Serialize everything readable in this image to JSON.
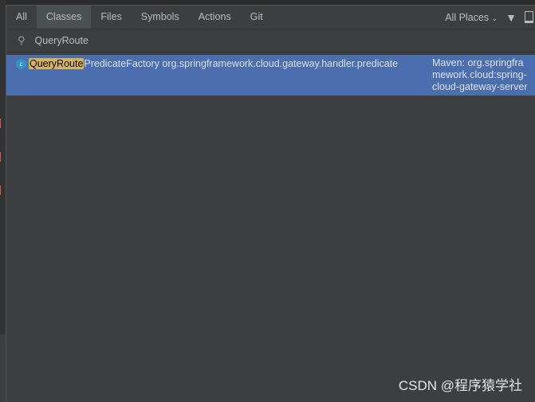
{
  "tabs": [
    {
      "label": "All"
    },
    {
      "label": "Classes"
    },
    {
      "label": "Files"
    },
    {
      "label": "Symbols"
    },
    {
      "label": "Actions"
    },
    {
      "label": "Git"
    }
  ],
  "active_tab": "Classes",
  "scope": {
    "label": "All Places"
  },
  "search": {
    "value": "QueryRoute"
  },
  "results": [
    {
      "match": "QueryRoute",
      "rest": "PredicateFactory",
      "package": "org.springframework.cloud.gateway.handler.predicate",
      "location": "Maven: org.springframework.cloud:spring-cloud-gateway-server"
    }
  ],
  "colors": {
    "selection": "#4b6eaf",
    "highlight": "#d8b35a",
    "background": "#3c3f41"
  },
  "watermark": "CSDN @程序猿学社"
}
